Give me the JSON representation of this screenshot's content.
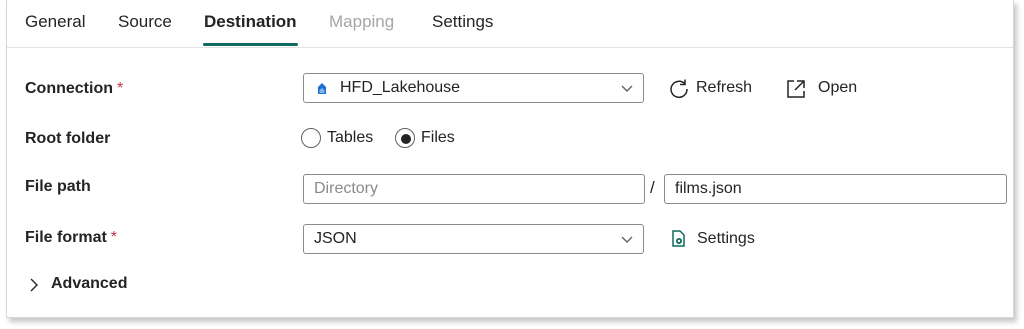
{
  "tabs": [
    {
      "label": "General",
      "state": "normal"
    },
    {
      "label": "Source",
      "state": "normal"
    },
    {
      "label": "Destination",
      "state": "active"
    },
    {
      "label": "Mapping",
      "state": "disabled"
    },
    {
      "label": "Settings",
      "state": "normal"
    }
  ],
  "connection": {
    "label": "Connection",
    "required_mark": "*",
    "value": "HFD_Lakehouse",
    "icon": "lakehouse-icon",
    "refresh_label": "Refresh",
    "open_label": "Open"
  },
  "root_folder": {
    "label": "Root folder",
    "options": [
      {
        "label": "Tables",
        "selected": false
      },
      {
        "label": "Files",
        "selected": true
      }
    ]
  },
  "file_path": {
    "label": "File path",
    "directory_placeholder": "Directory",
    "directory_value": "",
    "separator": "/",
    "file_name_value": "films.json"
  },
  "file_format": {
    "label": "File format",
    "required_mark": "*",
    "value": "JSON",
    "settings_label": "Settings"
  },
  "advanced": {
    "label": "Advanced",
    "expanded": false
  },
  "colors": {
    "accent": "#0f6b5f",
    "required": "#c4314b",
    "border": "#8a8a8a",
    "disabled_text": "#a6a6a6"
  }
}
